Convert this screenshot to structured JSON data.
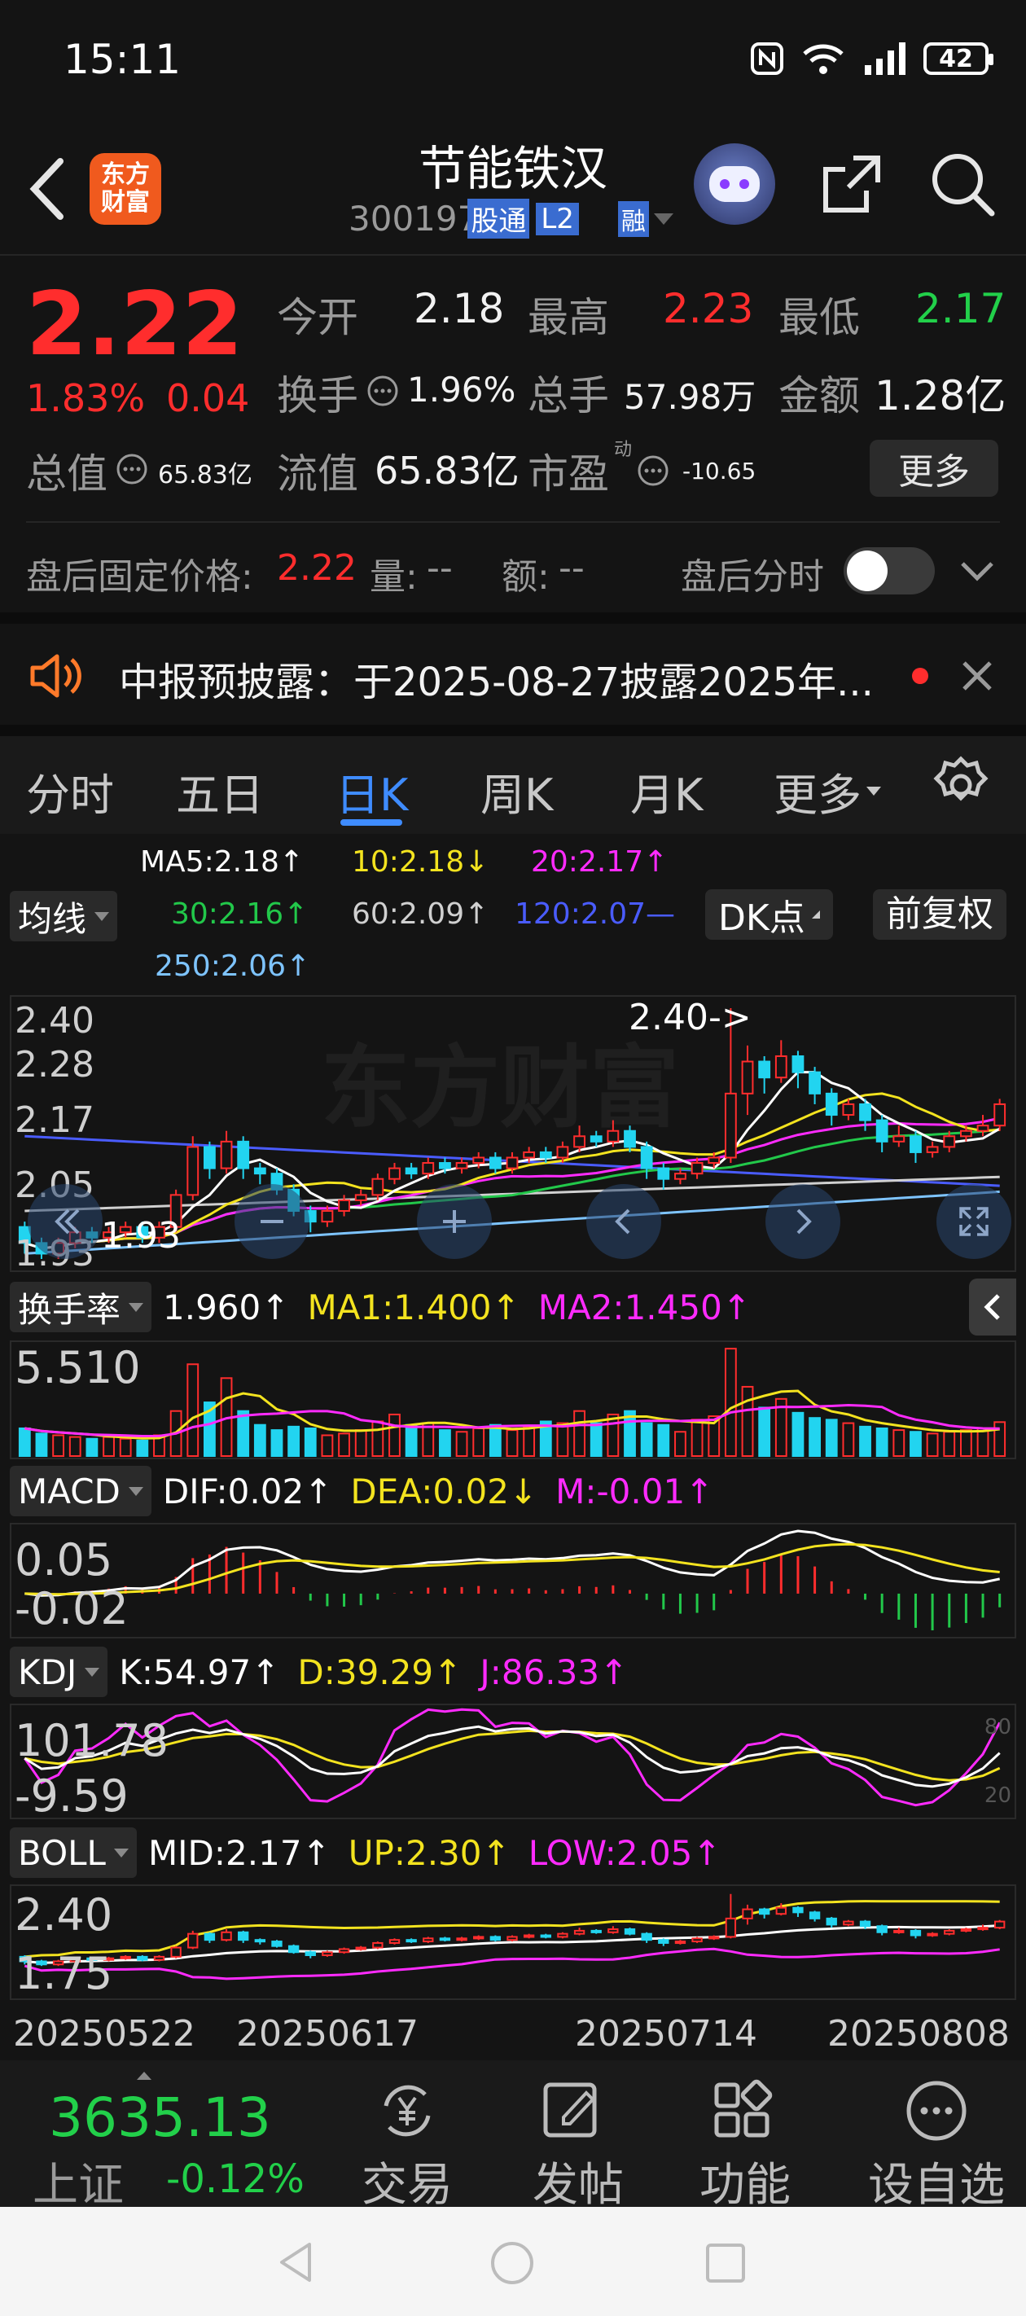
{
  "status": {
    "time": "15:11",
    "battery": "42",
    "net": "6"
  },
  "header": {
    "title": "节能铁汉",
    "code": "300197",
    "badge1": "股通",
    "badge2": "L2",
    "badge3": "融"
  },
  "quote": {
    "price": "2.22",
    "pct": "1.83%",
    "chg": "0.04",
    "open_label": "今开",
    "open": "2.18",
    "high_label": "最高",
    "high": "2.23",
    "low_label": "最低",
    "low": "2.17",
    "turn_label": "换手",
    "turn": "1.96%",
    "vol_label": "总手",
    "vol": "57.98万",
    "amt_label": "金额",
    "amt": "1.28亿",
    "mcap_label": "总值",
    "mcap": "65.83亿",
    "float_label": "流值",
    "float": "65.83亿",
    "pe_label": "市盈",
    "pe_sup": "动",
    "pe": "-10.65",
    "more": "更多"
  },
  "afterhours": {
    "label": "盘后固定价格:",
    "price": "2.22",
    "vol_label": "量:",
    "vol": "--",
    "amt_label": "额:",
    "amt": "--",
    "toggle_label": "盘后分时"
  },
  "notice": {
    "text": "中报预披露：于2025-08-27披露2025年..."
  },
  "tabs": [
    "分时",
    "五日",
    "日K",
    "周K",
    "月K",
    "更多"
  ],
  "ma": {
    "ma5": "MA5:2.18↑",
    "ma10": "10:2.18↓",
    "ma20": "20:2.17↑",
    "ma30": "30:2.16↑",
    "ma60": "60:2.09↑",
    "ma120": "120:2.07—",
    "ma250": "250:2.06↑",
    "selector": "均线",
    "dk": "DK点",
    "fq": "前复权"
  },
  "kline": {
    "y_top": "2.40",
    "y2": "2.28",
    "y3": "2.17",
    "y4": "2.05",
    "y_bot": "1.93",
    "y_bot2": "1.93",
    "hi_marker": "2.40->",
    "lo_marker": "1.93"
  },
  "turnover": {
    "selector": "换手率",
    "val": "1.960↑",
    "ma1": "MA1:1.400↑",
    "ma2": "MA2:1.450↑",
    "ymax": "5.510"
  },
  "macd": {
    "selector": "MACD",
    "dif": "DIF:0.02↑",
    "dea": "DEA:0.02↓",
    "m": "M:-0.01↑",
    "ytop": "0.05",
    "ybot": "-0.02"
  },
  "kdj": {
    "selector": "KDJ",
    "k": "K:54.97↑",
    "d": "D:39.29↑",
    "j": "J:86.33↑",
    "ytop": "101.78",
    "ybot": "-9.59",
    "r1": "80",
    "r2": "20"
  },
  "boll": {
    "selector": "BOLL",
    "mid": "MID:2.17↑",
    "up": "UP:2.30↑",
    "low": "LOW:2.05↑",
    "ytop": "2.40",
    "ybot": "1.75"
  },
  "dates": [
    "20250522",
    "20250617",
    "20250714",
    "20250808"
  ],
  "bottom": {
    "index_value": "3635.13",
    "index_name": "上证",
    "index_pct": "-0.12%",
    "trade": "交易",
    "post": "发帖",
    "func": "功能",
    "fav": "设自选"
  },
  "colors": {
    "up": "#ff2d2d",
    "down": "#22d4f0",
    "ma5": "#ffffff",
    "ma10": "#f3e31f",
    "ma20": "#ff2bff",
    "ma30": "#22c84a",
    "ma60": "#d0d0d0",
    "ma120": "#4a5cff",
    "ma250": "#7ec4ff",
    "accent": "#3f8cff"
  },
  "chart_data": {
    "type": "candlestick",
    "title": "节能铁汉 日K",
    "x_start": "20250522",
    "x_end": "20250811",
    "ylim": [
      1.93,
      2.4
    ],
    "candles": [
      [
        1.99,
        1.96,
        2.0,
        1.94
      ],
      [
        1.96,
        1.94,
        1.97,
        1.93
      ],
      [
        1.94,
        1.96,
        1.97,
        1.93
      ],
      [
        1.96,
        1.98,
        1.99,
        1.95
      ],
      [
        1.98,
        1.97,
        1.99,
        1.96
      ],
      [
        1.97,
        1.98,
        1.99,
        1.96
      ],
      [
        1.98,
        1.99,
        2.0,
        1.97
      ],
      [
        1.99,
        1.97,
        2.0,
        1.96
      ],
      [
        1.97,
        1.99,
        2.0,
        1.96
      ],
      [
        1.99,
        2.05,
        2.06,
        1.98
      ],
      [
        2.05,
        2.14,
        2.16,
        2.04
      ],
      [
        2.14,
        2.1,
        2.15,
        2.08
      ],
      [
        2.1,
        2.15,
        2.17,
        2.09
      ],
      [
        2.15,
        2.1,
        2.16,
        2.08
      ],
      [
        2.1,
        2.09,
        2.11,
        2.07
      ],
      [
        2.09,
        2.06,
        2.1,
        2.05
      ],
      [
        2.06,
        2.02,
        2.07,
        2.01
      ],
      [
        2.02,
        2.0,
        2.03,
        1.98
      ],
      [
        2.0,
        2.02,
        2.03,
        1.99
      ],
      [
        2.02,
        2.04,
        2.05,
        2.01
      ],
      [
        2.04,
        2.05,
        2.06,
        2.03
      ],
      [
        2.05,
        2.08,
        2.09,
        2.04
      ],
      [
        2.08,
        2.1,
        2.11,
        2.07
      ],
      [
        2.1,
        2.09,
        2.11,
        2.08
      ],
      [
        2.09,
        2.11,
        2.12,
        2.08
      ],
      [
        2.11,
        2.1,
        2.12,
        2.09
      ],
      [
        2.1,
        2.11,
        2.12,
        2.09
      ],
      [
        2.11,
        2.12,
        2.13,
        2.1
      ],
      [
        2.12,
        2.1,
        2.13,
        2.09
      ],
      [
        2.1,
        2.12,
        2.13,
        2.09
      ],
      [
        2.12,
        2.13,
        2.14,
        2.11
      ],
      [
        2.13,
        2.12,
        2.14,
        2.11
      ],
      [
        2.12,
        2.14,
        2.15,
        2.11
      ],
      [
        2.14,
        2.16,
        2.18,
        2.13
      ],
      [
        2.16,
        2.15,
        2.17,
        2.14
      ],
      [
        2.15,
        2.17,
        2.19,
        2.14
      ],
      [
        2.17,
        2.14,
        2.18,
        2.13
      ],
      [
        2.14,
        2.1,
        2.15,
        2.08
      ],
      [
        2.1,
        2.08,
        2.11,
        2.06
      ],
      [
        2.08,
        2.09,
        2.1,
        2.07
      ],
      [
        2.09,
        2.11,
        2.12,
        2.08
      ],
      [
        2.11,
        2.12,
        2.13,
        2.1
      ],
      [
        2.12,
        2.24,
        2.4,
        2.11
      ],
      [
        2.24,
        2.3,
        2.33,
        2.2
      ],
      [
        2.3,
        2.27,
        2.31,
        2.24
      ],
      [
        2.27,
        2.31,
        2.34,
        2.26
      ],
      [
        2.31,
        2.28,
        2.32,
        2.25
      ],
      [
        2.28,
        2.24,
        2.29,
        2.22
      ],
      [
        2.24,
        2.2,
        2.25,
        2.18
      ],
      [
        2.2,
        2.22,
        2.23,
        2.19
      ],
      [
        2.22,
        2.19,
        2.23,
        2.17
      ],
      [
        2.19,
        2.15,
        2.2,
        2.13
      ],
      [
        2.15,
        2.16,
        2.18,
        2.14
      ],
      [
        2.16,
        2.13,
        2.17,
        2.11
      ],
      [
        2.13,
        2.14,
        2.15,
        2.12
      ],
      [
        2.14,
        2.16,
        2.17,
        2.13
      ],
      [
        2.16,
        2.17,
        2.18,
        2.15
      ],
      [
        2.17,
        2.18,
        2.2,
        2.16
      ],
      [
        2.18,
        2.22,
        2.23,
        2.17
      ]
    ],
    "turnover": [
      1.6,
      1.3,
      1.2,
      1.1,
      1.0,
      1.1,
      1.0,
      0.9,
      1.2,
      2.6,
      5.3,
      3.1,
      4.5,
      2.6,
      1.8,
      1.5,
      1.7,
      1.6,
      1.2,
      1.3,
      1.5,
      2.0,
      2.4,
      1.8,
      1.9,
      1.5,
      1.4,
      1.6,
      1.8,
      1.5,
      1.7,
      2.0,
      1.9,
      2.6,
      1.9,
      2.4,
      2.6,
      1.9,
      1.8,
      1.4,
      2.1,
      2.3,
      6.2,
      4.0,
      2.8,
      3.3,
      2.5,
      2.2,
      2.1,
      1.9,
      1.7,
      1.6,
      1.5,
      1.4,
      1.3,
      1.4,
      1.5,
      1.6,
      1.96
    ]
  }
}
